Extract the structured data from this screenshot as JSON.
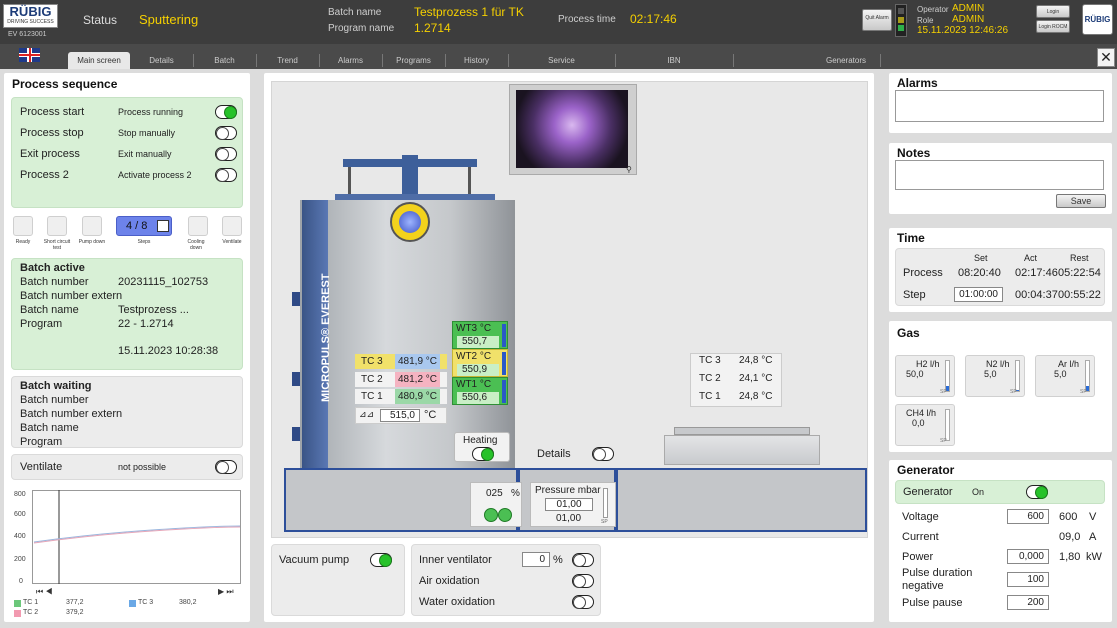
{
  "header": {
    "logo": "RÜBIG",
    "logo_sub": "DRIVING SUCCESS",
    "device_id": "EV 6123001",
    "status_label": "Status",
    "status_value": "Sputtering",
    "batch_name_label": "Batch name",
    "batch_name_value": "Testprozess 1 für TK",
    "program_name_label": "Program name",
    "program_name_value": "1.2714",
    "process_time_label": "Process time",
    "process_time_value": "02:17:46",
    "quit_alarm": "Quit Alarm",
    "operator_label": "Operator",
    "operator_value": "ADMIN",
    "role_label": "Role",
    "role_value": "ADMIN",
    "datetime": "15.11.2023 12:46:26",
    "login": "Login",
    "login_rocm": "Login ROCM",
    "brand_logo": "RÜBIG"
  },
  "tabs": [
    "Main screen",
    "Details",
    "Batch",
    "Trend",
    "Alarms",
    "Programs",
    "History",
    "Service",
    "IBN",
    "Generators"
  ],
  "process_sequence": {
    "title": "Process sequence",
    "rows": [
      {
        "label": "Process start",
        "status": "Process running",
        "on": true
      },
      {
        "label": "Process stop",
        "status": "Stop manually",
        "on": false
      },
      {
        "label": "Exit process",
        "status": "Exit manually",
        "on": false
      },
      {
        "label": "Process 2",
        "status": "Activate process 2",
        "on": false
      }
    ],
    "steps": [
      "Ready",
      "Short circuit test",
      "Pump down",
      "Steps",
      "Cooling down",
      "Ventilate"
    ],
    "step_counter": "4 / 8"
  },
  "batch_active": {
    "title": "Batch active",
    "rows": [
      {
        "label": "Batch number",
        "value": "20231115_102753"
      },
      {
        "label": "Batch number extern",
        "value": ""
      },
      {
        "label": "Batch name",
        "value": "Testprozess ..."
      },
      {
        "label": "Program",
        "value": "22 - 1.2714"
      }
    ],
    "timestamp": "15.11.2023 10:28:38"
  },
  "batch_waiting": {
    "title": "Batch waiting",
    "rows": [
      "Batch number",
      "Batch number extern",
      "Batch name",
      "Program"
    ]
  },
  "ventilate": {
    "label": "Ventilate",
    "status": "not possible"
  },
  "trend": {
    "y_ticks": [
      "800",
      "600",
      "400",
      "200",
      "0"
    ],
    "legend": [
      {
        "name": "TC 1",
        "value": "377,2",
        "color": "#6bc77a"
      },
      {
        "name": "TC 3",
        "value": "380,2",
        "color": "#6aa8e6"
      },
      {
        "name": "TC 2",
        "value": "379,2",
        "color": "#f29ab0"
      }
    ]
  },
  "machine": {
    "brand": "MICROPULS® EVEREST",
    "tc_left": [
      {
        "label": "TC 3",
        "value": "481,9 °C",
        "color": "#a9c8ef"
      },
      {
        "label": "TC 2",
        "value": "481,2 °C",
        "color": "#f5b3c1"
      },
      {
        "label": "TC 1",
        "value": "480,9 °C",
        "color": "#9bd8a7"
      }
    ],
    "setpoint": "515,0",
    "setpoint_unit": "°C",
    "wt": [
      {
        "label": "WT3 °C",
        "value": "550,7"
      },
      {
        "label": "WT2 °C",
        "value": "550,9"
      },
      {
        "label": "WT1 °C",
        "value": "550,6"
      }
    ],
    "heating_label": "Heating",
    "details_label": "Details",
    "tc_right": [
      {
        "label": "TC 3",
        "value": "24,8 °C"
      },
      {
        "label": "TC 2",
        "value": "24,1 °C"
      },
      {
        "label": "TC 1",
        "value": "24,8 °C"
      }
    ],
    "valve_value": "025",
    "valve_unit": "%",
    "pressure_label": "Pressure mbar",
    "pressure_set": "01,00",
    "pressure_act": "01,00",
    "pressure_sp": "SP"
  },
  "bottom": {
    "vacuum_pump": "Vacuum pump",
    "inner_ventilator": "Inner ventilator",
    "inner_ventilator_value": "0",
    "inner_ventilator_unit": "%",
    "air_oxidation": "Air oxidation",
    "water_oxidation": "Water oxidation"
  },
  "alarms": {
    "title": "Alarms"
  },
  "notes": {
    "title": "Notes",
    "save": "Save"
  },
  "time": {
    "title": "Time",
    "headers": [
      "Set",
      "Act",
      "Rest"
    ],
    "rows": [
      {
        "label": "Process",
        "set": "08:20:40",
        "act": "02:17:46",
        "rest": "05:22:54"
      },
      {
        "label": "Step",
        "set": "01:00:00",
        "act": "00:04:37",
        "rest": "00:55:22"
      }
    ]
  },
  "gas": {
    "title": "Gas",
    "items": [
      {
        "label": "H2 l/h",
        "value": "50,0",
        "sp": "SP"
      },
      {
        "label": "N2 l/h",
        "value": "5,0",
        "sp": "SP"
      },
      {
        "label": "Ar l/h",
        "value": "5,0",
        "sp": "SP"
      },
      {
        "label": "CH4 l/h",
        "value": "0,0",
        "sp": "SP"
      }
    ]
  },
  "generator": {
    "title": "Generator",
    "gen_label": "Generator",
    "gen_state": "On",
    "rows": [
      {
        "label": "Voltage",
        "set": "600",
        "act": "600",
        "unit": "V"
      },
      {
        "label": "Current",
        "set": "",
        "act": "09,0",
        "unit": "A"
      },
      {
        "label": "Power",
        "set": "0,000",
        "act": "1,80",
        "unit": "kW"
      },
      {
        "label": "Pulse duration negative",
        "set": "100",
        "act": "",
        "unit": ""
      },
      {
        "label": "Pulse pause",
        "set": "200",
        "act": "",
        "unit": ""
      }
    ]
  }
}
